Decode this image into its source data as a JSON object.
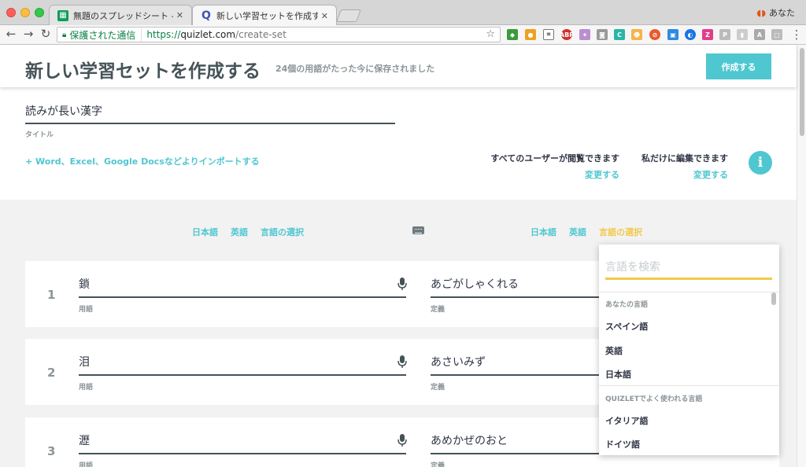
{
  "browser": {
    "tabs": [
      {
        "title": "無題のスプレッドシート - Goo",
        "icon": "sheets-icon"
      },
      {
        "title": "新しい学習セットを作成する | Q",
        "icon": "quizlet-icon"
      }
    ],
    "profile_name": "あなた",
    "secure_label": "保護された通信",
    "url_scheme": "https://",
    "url_host": "quizlet.com",
    "url_path": "/create-set"
  },
  "header": {
    "title": "新しい学習セットを作成する",
    "saved_status": "24個の用語がたった今に保存されました",
    "create_button": "作成する"
  },
  "set": {
    "title_value": "読みが長い漢字",
    "title_label": "タイトル",
    "import_link": "+ Word、Excel、Google Docsなどよりインポートする",
    "visibility_text": "すべてのユーザーが閲覧できます",
    "visibility_change": "変更する",
    "edit_text": "私だけに編集できます",
    "edit_change": "変更する",
    "info_icon_label": "i"
  },
  "languages": {
    "term_options": [
      "日本語",
      "英語",
      "言語の選択"
    ],
    "def_options": [
      "日本語",
      "英語",
      "言語の選択"
    ]
  },
  "cards": [
    {
      "num": "1",
      "term": "鎖",
      "definition": "あごがしゃくれる",
      "term_label": "用語",
      "def_label": "定義"
    },
    {
      "num": "2",
      "term": "泪",
      "definition": "あさいみず",
      "term_label": "用語",
      "def_label": "定義"
    },
    {
      "num": "3",
      "term": "瀝",
      "definition": "あめかぜのおと",
      "term_label": "用語",
      "def_label": "定義"
    }
  ],
  "dropdown": {
    "search_placeholder": "言語を検索",
    "your_languages_heading": "あなたの言語",
    "your_languages": [
      "スペイン語",
      "英語",
      "日本語"
    ],
    "popular_heading": "QUIZLETでよく使われる言語",
    "popular": [
      "イタリア語",
      "ドイツ語"
    ]
  },
  "colors": {
    "accent": "#4fc7d0",
    "highlight": "#f2c94c",
    "text": "#455358"
  }
}
